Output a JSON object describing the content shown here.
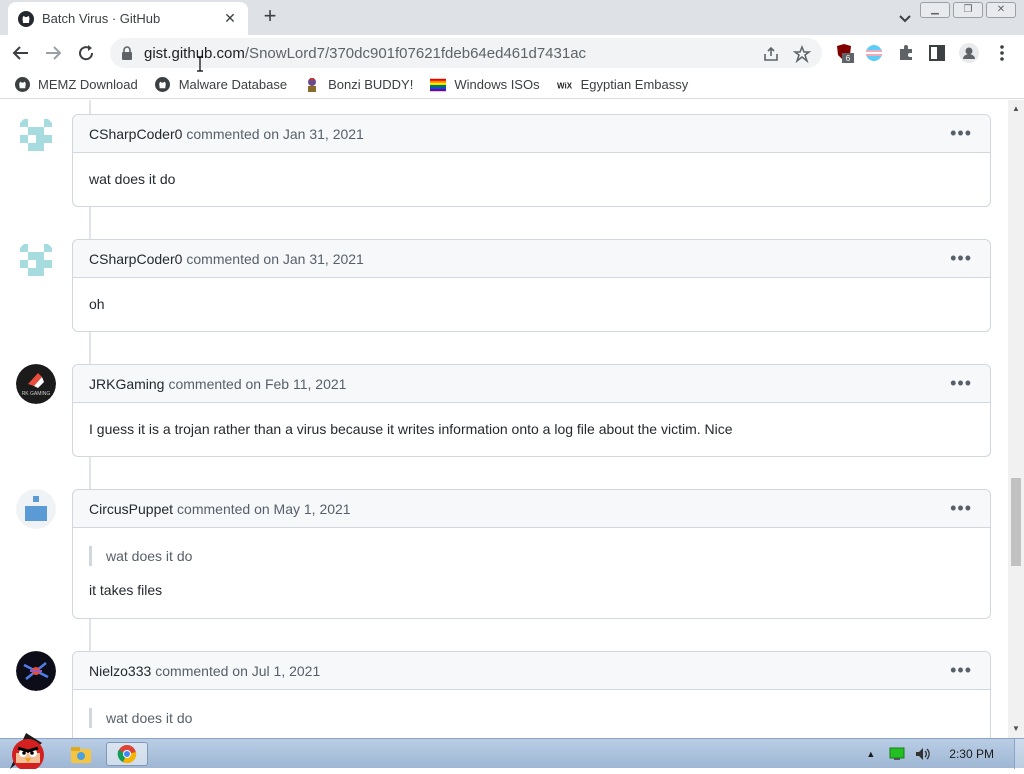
{
  "browser": {
    "tab_title": "Batch Virus · GitHub",
    "url_host": "gist.github.com",
    "url_path": "/SnowLord7/370dc901f07621fdeb64ed461d7431ac",
    "extension_badge": "6"
  },
  "bookmarks": [
    {
      "label": "MEMZ Download",
      "icon": "github-icon"
    },
    {
      "label": "Malware Database",
      "icon": "github-icon"
    },
    {
      "label": "Bonzi BUDDY!",
      "icon": "bonzi-icon"
    },
    {
      "label": "Windows ISOs",
      "icon": "rainbow-flag-icon"
    },
    {
      "label": "Egyptian Embassy",
      "icon": "wix-icon"
    }
  ],
  "comments": [
    {
      "author": "CSharpCoder0",
      "action": "commented on Jan 31, 2021",
      "quote": "",
      "body": "wat does it do"
    },
    {
      "author": "CSharpCoder0",
      "action": "commented on Jan 31, 2021",
      "quote": "",
      "body": "oh"
    },
    {
      "author": "JRKGaming",
      "action": "commented on Feb 11, 2021",
      "quote": "",
      "body": "I guess it is a trojan rather than a virus because it writes information onto a log file about the victim. Nice"
    },
    {
      "author": "CircusPuppet",
      "action": "commented on May 1, 2021",
      "quote": "wat does it do",
      "body": "it takes files"
    },
    {
      "author": "Nielzo333",
      "action": "commented on Jul 1, 2021",
      "quote": "wat does it do",
      "body": ""
    }
  ],
  "taskbar": {
    "clock": "2:30 PM"
  },
  "colors": {
    "accent": "#0969da",
    "header_bg": "#f6f8fa",
    "border": "#d0d7de"
  }
}
